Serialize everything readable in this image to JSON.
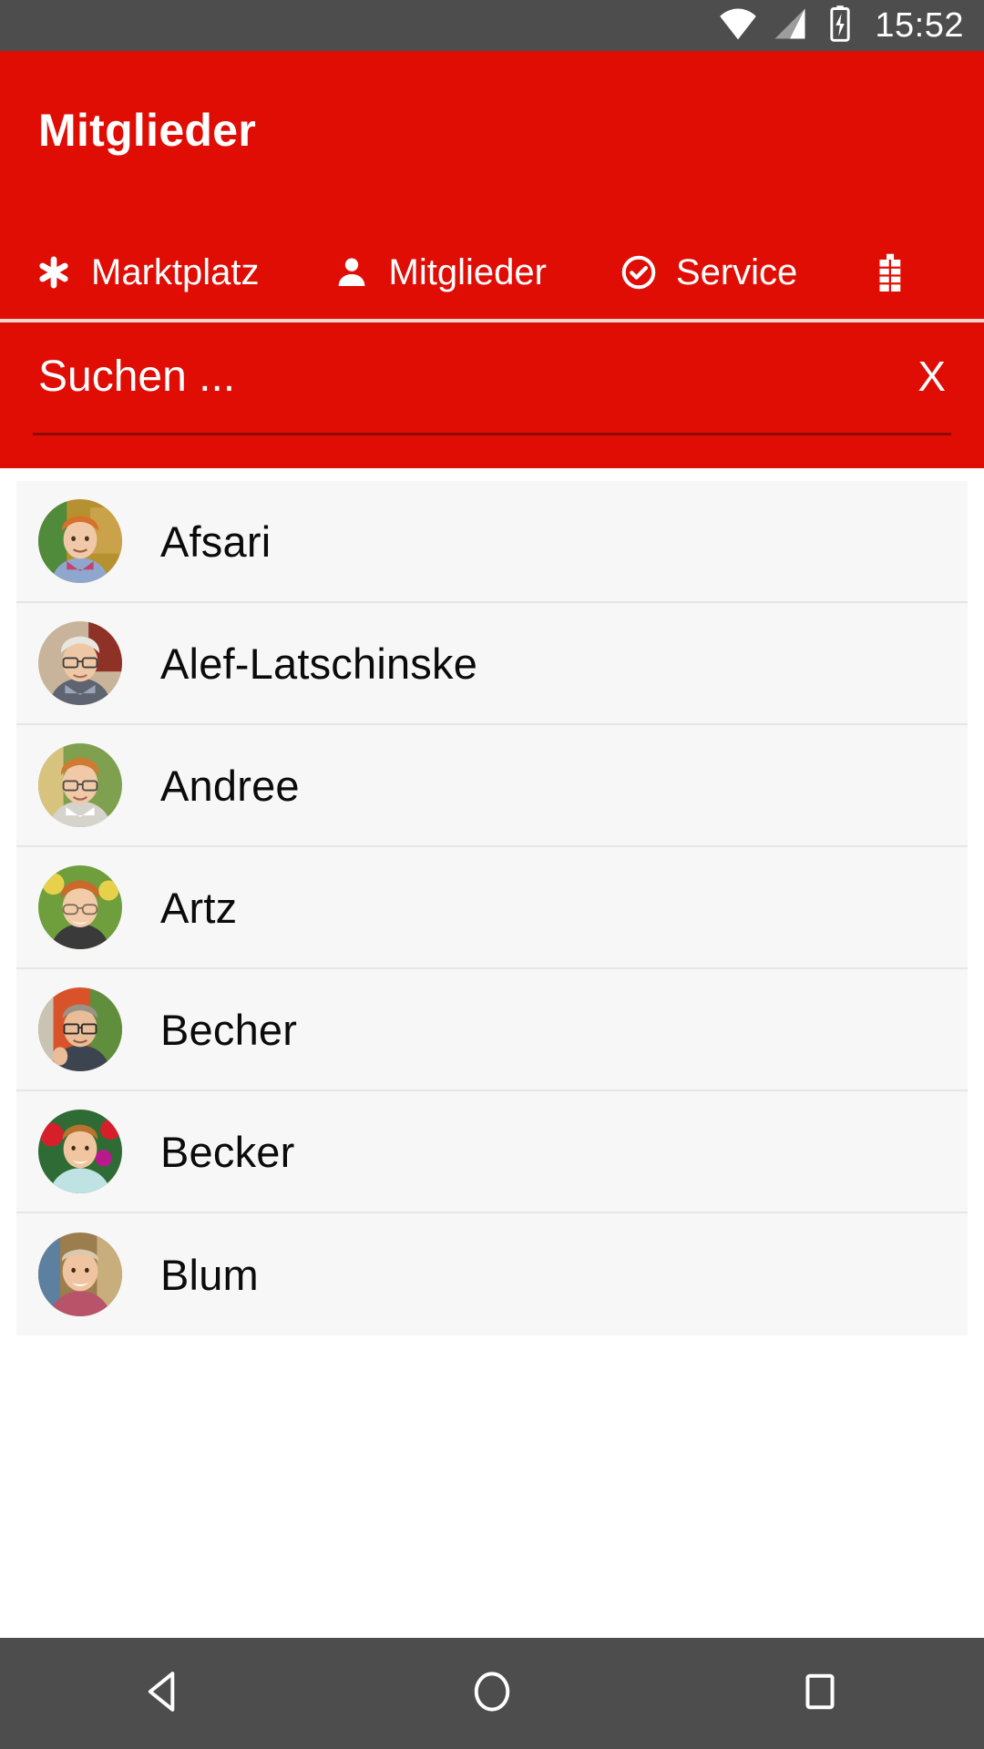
{
  "status_bar": {
    "time": "15:52",
    "icons": [
      "wifi-icon",
      "cell-signal-icon",
      "battery-charging-icon"
    ],
    "background_color": "#4d4d4d"
  },
  "app_bar": {
    "title": "Mitglieder",
    "background_color": "#e00d05",
    "text_color": "#ffffff",
    "tabs": [
      {
        "label": "Marktplatz",
        "icon": "asterisk-icon",
        "active": false
      },
      {
        "label": "Mitglieder",
        "icon": "person-icon",
        "active": true
      },
      {
        "label": "Service",
        "icon": "check-circle-icon",
        "active": false
      },
      {
        "label": "",
        "icon": "building-icon",
        "active": false,
        "partially_visible": true
      }
    ]
  },
  "search": {
    "placeholder": "Suchen ...",
    "value": "",
    "clear_label": "X"
  },
  "members": {
    "rows": [
      {
        "name": "Afsari",
        "avatar": "portrait-photo"
      },
      {
        "name": "Alef-Latschinske",
        "avatar": "portrait-photo"
      },
      {
        "name": "Andree",
        "avatar": "portrait-photo"
      },
      {
        "name": "Artz",
        "avatar": "portrait-photo"
      },
      {
        "name": "Becher",
        "avatar": "portrait-photo"
      },
      {
        "name": "Becker",
        "avatar": "portrait-photo"
      },
      {
        "name": "Blum",
        "avatar": "portrait-photo"
      }
    ]
  },
  "nav_bar": {
    "background_color": "#4d4d4d",
    "buttons": [
      {
        "icon": "back-triangle-icon"
      },
      {
        "icon": "home-circle-icon"
      },
      {
        "icon": "recents-square-icon"
      }
    ]
  }
}
